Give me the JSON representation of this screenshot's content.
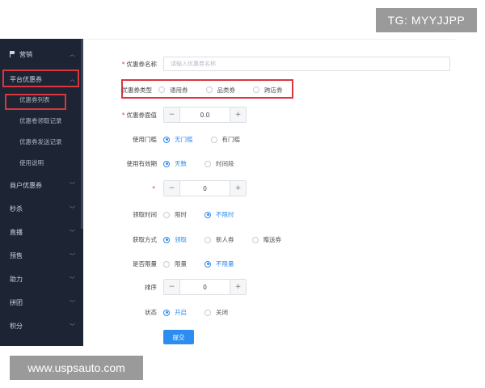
{
  "watermarks": {
    "tg": "TG: MYYJJPP",
    "site": "www.uspsauto.com"
  },
  "sidebar": {
    "items": [
      {
        "label": "营销"
      },
      {
        "label": "平台优惠券"
      },
      {
        "label": "优惠券列表"
      },
      {
        "label": "优惠卷领取记录"
      },
      {
        "label": "优惠券发送记录"
      },
      {
        "label": "使用说明"
      },
      {
        "label": "商户优惠券"
      },
      {
        "label": "秒杀"
      },
      {
        "label": "直播"
      },
      {
        "label": "预售"
      },
      {
        "label": "助力"
      },
      {
        "label": "拼团"
      },
      {
        "label": "积分"
      }
    ]
  },
  "form": {
    "name": {
      "label": "优惠券名称",
      "placeholder": "请输入优惠券名称"
    },
    "type": {
      "label": "优惠券类型",
      "options": [
        "通用券",
        "品类券",
        "跨店券"
      ]
    },
    "value": {
      "label": "优惠券面值",
      "value": "0.0",
      "minus": "−",
      "plus": "+"
    },
    "threshold": {
      "label": "使用门槛",
      "options": [
        "无门槛",
        "有门槛"
      ]
    },
    "validity": {
      "label": "使用有效期",
      "options": [
        "天数",
        "时间段"
      ]
    },
    "days": {
      "value": "0",
      "minus": "−",
      "plus": "+",
      "mark": "*"
    },
    "claim_time": {
      "label": "领取时间",
      "options": [
        "限时",
        "不限时"
      ]
    },
    "claim_method": {
      "label": "获取方式",
      "options": [
        "领取",
        "新人券",
        "赠送券"
      ]
    },
    "limit": {
      "label": "是否限量",
      "options": [
        "限量",
        "不限量"
      ]
    },
    "sort": {
      "label": "排序",
      "value": "0",
      "minus": "−",
      "plus": "+"
    },
    "status": {
      "label": "状态",
      "options": [
        "开启",
        "关闭"
      ]
    },
    "submit": "提交"
  },
  "colors": {
    "accent": "#2d8cf0",
    "sidebar_bg": "#1d2433",
    "highlight": "#d9363e"
  }
}
